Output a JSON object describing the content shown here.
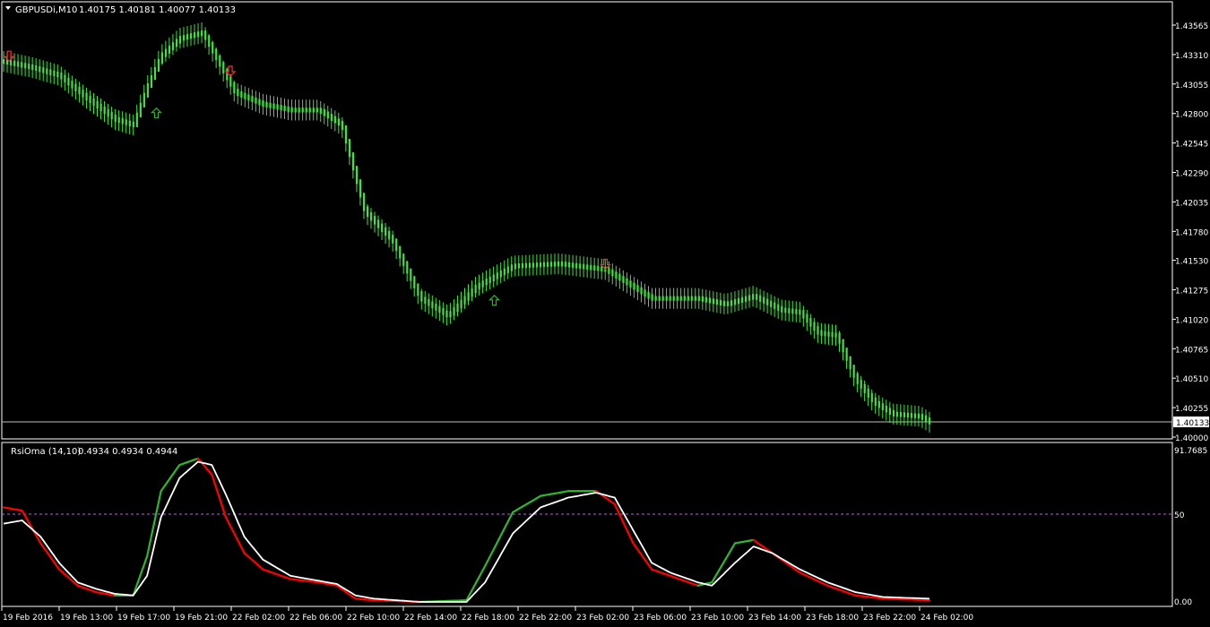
{
  "window": {
    "symbol_title": "GBPUSDi,M10",
    "ohlc": "1.40175 1.40181 1.40077 1.40133"
  },
  "indicator": {
    "title": "RsiOma (14,10)",
    "values": "0.4934 0.4934 0.4944"
  },
  "colors": {
    "background": "#000000",
    "candles": "#3fe33f",
    "frame": "#ffffff",
    "rsi_up": "#2fb52f",
    "rsi_down": "#ff0000",
    "signal": "#ffffff",
    "level_line": "#b06ad0",
    "arrow_up": "#2fb52f",
    "arrow_down": "#ff2a2a"
  },
  "price_axis": {
    "ticks": [
      "1.43565",
      "1.43310",
      "1.43055",
      "1.42800",
      "1.42545",
      "1.42290",
      "1.42035",
      "1.41780",
      "1.41530",
      "1.41275",
      "1.41020",
      "1.40765",
      "1.40510",
      "1.40255",
      "1.40000"
    ],
    "current_price": "1.40133"
  },
  "rsi_axis": {
    "top": "91.7685",
    "mid": "50",
    "bottom": "0.00"
  },
  "time_axis": {
    "labels": [
      "19 Feb 2016",
      "19 Feb 13:00",
      "19 Feb 17:00",
      "19 Feb 21:00",
      "22 Feb 02:00",
      "22 Feb 06:00",
      "22 Feb 10:00",
      "22 Feb 14:00",
      "22 Feb 18:00",
      "22 Feb 22:00",
      "23 Feb 02:00",
      "23 Feb 06:00",
      "23 Feb 10:00",
      "23 Feb 14:00",
      "23 Feb 18:00",
      "23 Feb 22:00",
      "24 Feb 02:00"
    ]
  },
  "chart_data": [
    {
      "type": "candlestick",
      "title": "GBPUSDi,M10",
      "ylim": [
        1.4,
        1.4357
      ],
      "price_path_x": [
        0,
        0.03,
        0.06,
        0.09,
        0.12,
        0.14,
        0.155,
        0.17,
        0.19,
        0.215,
        0.225,
        0.25,
        0.28,
        0.31,
        0.34,
        0.365,
        0.39,
        0.42,
        0.45,
        0.48,
        0.51,
        0.55,
        0.6,
        0.65,
        0.7,
        0.75,
        0.78,
        0.81,
        0.84,
        0.86,
        0.88,
        0.9,
        0.92,
        0.94,
        0.96,
        0.99,
        1.0
      ],
      "price_path_y": [
        1.4325,
        1.432,
        1.4313,
        1.4293,
        1.4275,
        1.427,
        1.4303,
        1.433,
        1.4345,
        1.435,
        1.4335,
        1.4298,
        1.4288,
        1.4283,
        1.4283,
        1.427,
        1.4195,
        1.417,
        1.412,
        1.4105,
        1.413,
        1.4148,
        1.415,
        1.4145,
        1.412,
        1.412,
        1.4115,
        1.4122,
        1.411,
        1.4108,
        1.409,
        1.4088,
        1.405,
        1.403,
        1.402,
        1.4018,
        1.4013
      ],
      "arrows": [
        {
          "dir": "down",
          "x": 0.006,
          "price": 1.433
        },
        {
          "dir": "up",
          "x": 0.165,
          "price": 1.428
        },
        {
          "dir": "down",
          "x": 0.245,
          "price": 1.4317
        },
        {
          "dir": "up",
          "x": 0.53,
          "price": 1.4118
        },
        {
          "dir": "down",
          "x": 0.65,
          "price": 1.415
        }
      ]
    },
    {
      "type": "line",
      "title": "RsiOma (14,10)",
      "ylim": [
        0,
        91.7685
      ],
      "level": 50,
      "x": [
        0,
        0.02,
        0.04,
        0.06,
        0.08,
        0.1,
        0.12,
        0.14,
        0.155,
        0.17,
        0.19,
        0.21,
        0.225,
        0.24,
        0.26,
        0.28,
        0.31,
        0.34,
        0.36,
        0.38,
        0.4,
        0.45,
        0.5,
        0.52,
        0.55,
        0.58,
        0.61,
        0.64,
        0.66,
        0.68,
        0.7,
        0.72,
        0.75,
        0.765,
        0.79,
        0.81,
        0.83,
        0.86,
        0.89,
        0.92,
        0.95,
        1.0
      ],
      "series": [
        {
          "name": "RsiOma",
          "values": [
            58,
            56,
            36,
            20,
            10,
            6,
            4,
            4,
            28,
            68,
            84,
            88,
            78,
            52,
            30,
            20,
            14,
            12,
            10,
            2,
            1,
            0,
            1,
            22,
            55,
            65,
            68,
            68,
            60,
            36,
            20,
            16,
            10,
            12,
            36,
            38,
            30,
            18,
            10,
            4,
            2,
            1
          ]
        },
        {
          "name": "Signal",
          "values": [
            48,
            50,
            40,
            24,
            12,
            8,
            5,
            4,
            16,
            52,
            76,
            86,
            84,
            66,
            40,
            26,
            16,
            13,
            11,
            4,
            2,
            0,
            0,
            12,
            42,
            58,
            64,
            67,
            64,
            44,
            24,
            18,
            12,
            10,
            24,
            34,
            30,
            20,
            12,
            6,
            3,
            2
          ]
        }
      ]
    }
  ]
}
